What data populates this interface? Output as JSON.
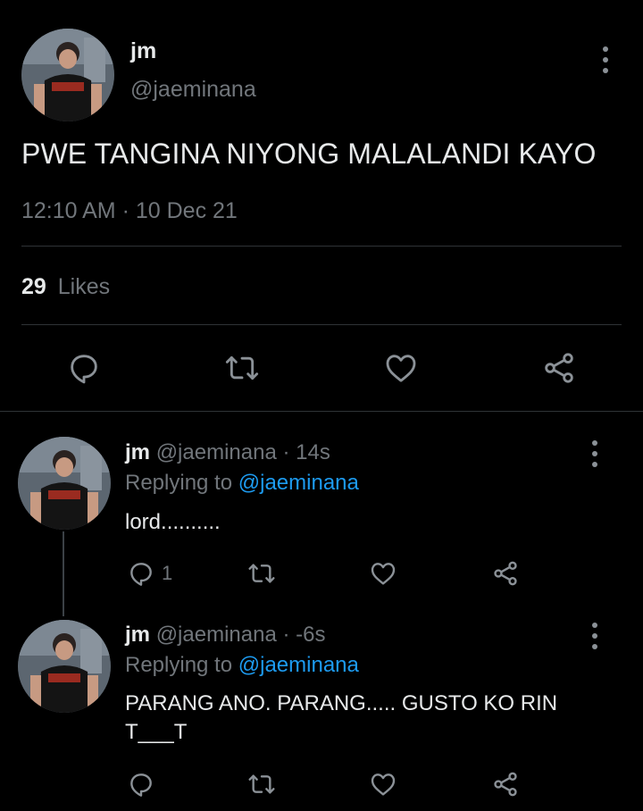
{
  "main_tweet": {
    "display_name": "jm",
    "handle": "@jaeminana",
    "text": "PWE TANGINA NIYONG MALALANDI KAYO",
    "time": "12:10 AM",
    "dot": "·",
    "date": "10 Dec 21",
    "likes_count": "29",
    "likes_label": "Likes"
  },
  "replies": [
    {
      "display_name": "jm",
      "handle": "@jaeminana",
      "sep": "·",
      "time": "14s",
      "replying_label": "Replying to",
      "replying_handle": "@jaeminana",
      "text": "lord..........",
      "reply_count": "1"
    },
    {
      "display_name": "jm",
      "handle": "@jaeminana",
      "sep": "·",
      "time": "-6s",
      "replying_label": "Replying to",
      "replying_handle": "@jaeminana",
      "text_line1": "PARANG ANO. PARANG..... GUSTO KO RIN",
      "text_line2": "T___T"
    }
  ],
  "icons": {
    "reply": "reply-bubble-icon",
    "retweet": "retweet-icon",
    "like": "heart-icon",
    "share": "share-icon",
    "menu": "more-vertical-icon"
  }
}
